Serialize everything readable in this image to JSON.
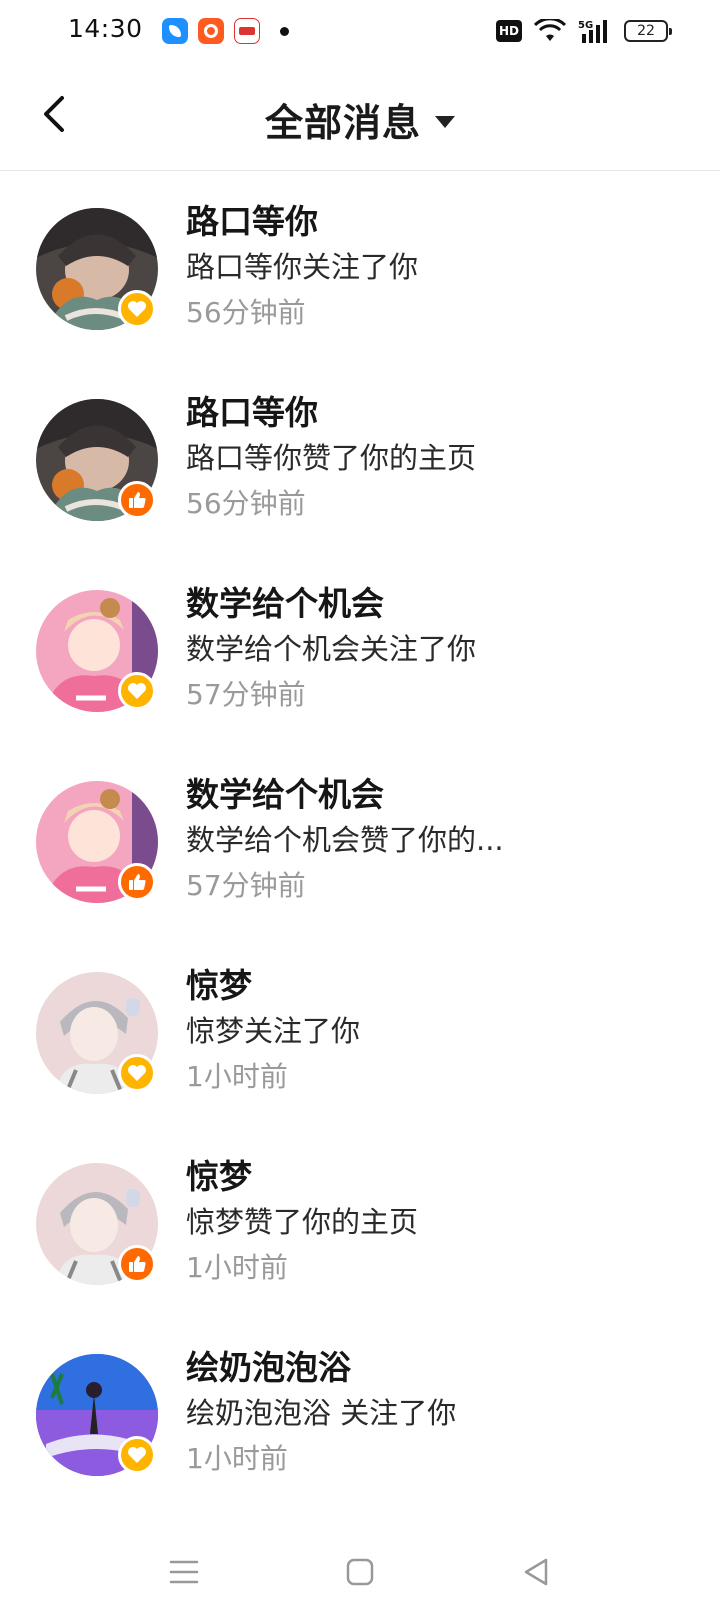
{
  "status_bar": {
    "time": "14:30",
    "battery": "22"
  },
  "header": {
    "title": "全部消息"
  },
  "messages": [
    {
      "name": "路口等你",
      "content": "路口等你关注了你",
      "time": "56分钟前",
      "type": "follow",
      "avatar": "boy-hat"
    },
    {
      "name": "路口等你",
      "content": "路口等你赞了你的主页",
      "time": "56分钟前",
      "type": "like",
      "avatar": "boy-hat"
    },
    {
      "name": "数学给个机会",
      "content": "数学给个机会关注了你",
      "time": "57分钟前",
      "type": "follow",
      "avatar": "pink-girl"
    },
    {
      "name": "数学给个机会",
      "content": "数学给个机会赞了你的...",
      "time": "57分钟前",
      "type": "like",
      "avatar": "pink-girl"
    },
    {
      "name": "惊梦",
      "content": "惊梦关注了你",
      "time": "1小时前",
      "type": "follow",
      "avatar": "grey-boy"
    },
    {
      "name": "惊梦",
      "content": "惊梦赞了你的主页",
      "time": "1小时前",
      "type": "like",
      "avatar": "grey-boy"
    },
    {
      "name": "绘奶泡泡浴",
      "content": "绘奶泡泡浴 关注了你",
      "time": "1小时前",
      "type": "follow",
      "avatar": "purple-scene"
    }
  ],
  "colors": {
    "follow_badge": "#ffb400",
    "like_badge": "#ff6a00",
    "time_text": "#9a9a9a"
  }
}
